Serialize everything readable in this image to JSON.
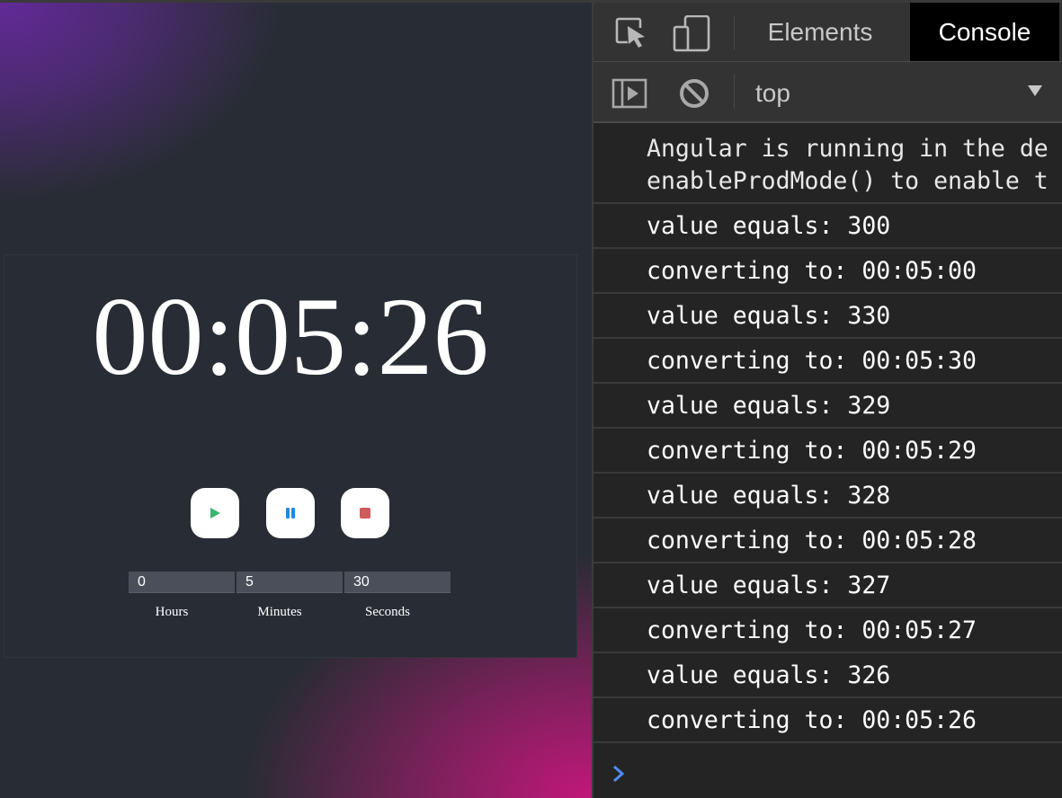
{
  "app": {
    "timer_display": "00:05:26",
    "controls": {
      "play_icon": "play-icon",
      "pause_icon": "pause-icon",
      "stop_icon": "stop-icon",
      "play_color": "#3cb371",
      "pause_color": "#1e88e5",
      "stop_color": "#cd5c5c"
    },
    "inputs": {
      "hours": "0",
      "minutes": "5",
      "seconds": "30"
    },
    "labels": {
      "hours": "Hours",
      "minutes": "Minutes",
      "seconds": "Seconds"
    }
  },
  "devtools": {
    "tabs": {
      "elements": "Elements",
      "console": "Console"
    },
    "toolbar": {
      "context": "top"
    },
    "console_messages": [
      {
        "line1": "Angular is running in the de",
        "line2": "enableProdMode() to enable t"
      },
      {
        "text": "value equals: 300"
      },
      {
        "text": "converting to: 00:05:00"
      },
      {
        "text": "value equals: 330"
      },
      {
        "text": "converting to: 00:05:30"
      },
      {
        "text": "value equals: 329"
      },
      {
        "text": "converting to: 00:05:29"
      },
      {
        "text": "value equals: 328"
      },
      {
        "text": "converting to: 00:05:28"
      },
      {
        "text": "value equals: 327"
      },
      {
        "text": "converting to: 00:05:27"
      },
      {
        "text": "value equals: 326"
      },
      {
        "text": "converting to: 00:05:26"
      }
    ],
    "prompt_color": "#4d8cf7"
  }
}
